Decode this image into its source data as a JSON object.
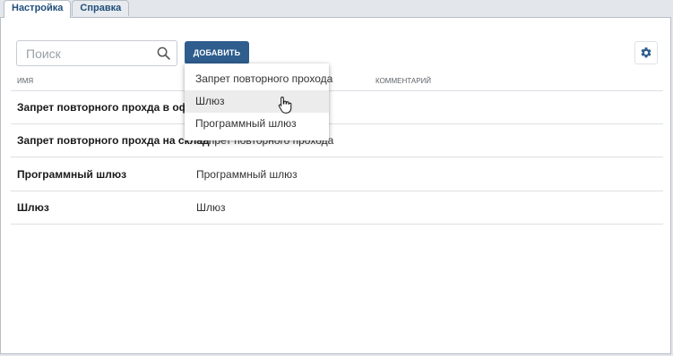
{
  "tabs": [
    {
      "label": "Настройка",
      "active": true
    },
    {
      "label": "Справка",
      "active": false
    }
  ],
  "toolbar": {
    "search_placeholder": "Поиск",
    "search_value": "",
    "add_label": "ДОБАВИТЬ",
    "settings_icon": "gear-icon",
    "accent_color": "#2e5d8e"
  },
  "table": {
    "columns": [
      "ИМЯ",
      "",
      "КОММЕНТАРИЙ"
    ],
    "rows": [
      {
        "name": "Запрет повторного прохда в офис",
        "type": "",
        "comment": ""
      },
      {
        "name": "Запрет повторного прохда на склад",
        "type": "Запрет повторного прохода",
        "comment": ""
      },
      {
        "name": "Программный шлюз",
        "type": "Программный шлюз",
        "comment": ""
      },
      {
        "name": "Шлюз",
        "type": "Шлюз",
        "comment": ""
      }
    ]
  },
  "add_menu": {
    "items": [
      "Запрет повторного прохода",
      "Шлюз",
      "Программный шлюз"
    ],
    "hovered_index": 1
  }
}
